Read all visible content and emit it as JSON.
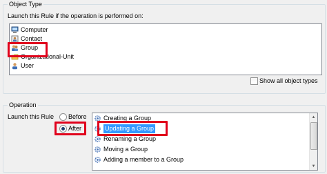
{
  "object_type": {
    "title": "Object Type",
    "prompt": "Launch this Rule if the operation is performed on:",
    "items": [
      {
        "label": "Computer",
        "icon": "computer-icon"
      },
      {
        "label": "Contact",
        "icon": "contact-icon"
      },
      {
        "label": "Group",
        "icon": "group-icon"
      },
      {
        "label": "Organizational-Unit",
        "icon": "ou-icon"
      },
      {
        "label": "User",
        "icon": "user-icon"
      }
    ],
    "selected": "Group",
    "show_all_label": "Show all object types",
    "show_all_checked": false
  },
  "operation": {
    "title": "Operation",
    "launch_label": "Launch this Rule",
    "before_label": "Before",
    "after_label": "After",
    "timing_selected": "After",
    "items": [
      {
        "label": "Creating a Group"
      },
      {
        "label": "Updating a Group"
      },
      {
        "label": "Renaming a Group"
      },
      {
        "label": "Moving a Group"
      },
      {
        "label": "Adding a member to a Group"
      }
    ],
    "selected": "Updating a Group"
  },
  "colors": {
    "highlight": "#e0001b",
    "selection": "#3399ff"
  }
}
